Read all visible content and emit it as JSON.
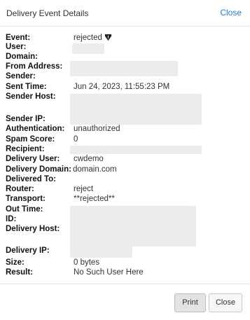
{
  "header": {
    "title": "Delivery Event Details",
    "close_label": "Close"
  },
  "fields": {
    "event": {
      "label": "Event:",
      "value": "rejected"
    },
    "user": {
      "label": "User:"
    },
    "domain": {
      "label": "Domain:"
    },
    "from_address": {
      "label": "From Address:"
    },
    "sender": {
      "label": "Sender:"
    },
    "sent_time": {
      "label": "Sent Time:",
      "value": "Jun 24, 2023, 11:55:23 PM"
    },
    "sender_host": {
      "label": "Sender Host:"
    },
    "sender_ip": {
      "label": "Sender IP:"
    },
    "authentication": {
      "label": "Authentication:",
      "value": "unauthorized"
    },
    "spam_score": {
      "label": "Spam Score:",
      "value": "0"
    },
    "recipient": {
      "label": "Recipient:"
    },
    "delivery_user": {
      "label": "Delivery User:",
      "value": "cwdemo"
    },
    "delivery_domain": {
      "label": "Delivery Domain:",
      "value": "domain.com"
    },
    "delivered_to": {
      "label": "Delivered To:"
    },
    "router": {
      "label": "Router:",
      "value": "reject"
    },
    "transport": {
      "label": "Transport:",
      "value": "**rejected**"
    },
    "out_time": {
      "label": "Out Time:"
    },
    "id": {
      "label": "ID:"
    },
    "delivery_host": {
      "label": "Delivery Host:"
    },
    "delivery_ip": {
      "label": "Delivery IP:"
    },
    "size": {
      "label": "Size:",
      "value": "0 bytes"
    },
    "result": {
      "label": "Result:",
      "value": "No Such User Here"
    }
  },
  "footer": {
    "print_label": "Print",
    "close_label": "Close"
  },
  "icons": {
    "event_status": "shield-icon"
  }
}
